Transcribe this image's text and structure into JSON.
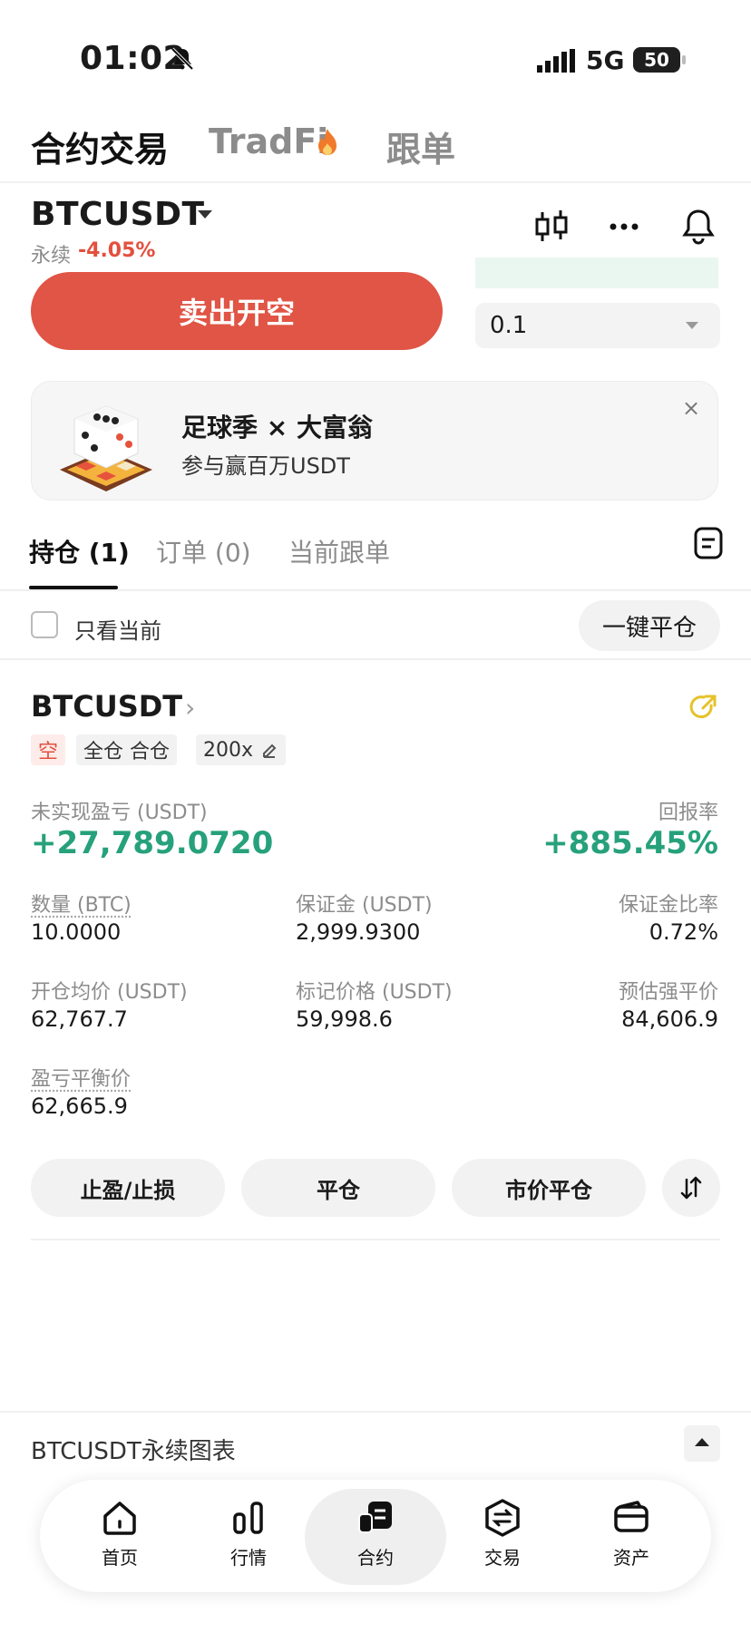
{
  "status_bar": {
    "time": "01:02",
    "network": "5G",
    "battery": "50"
  },
  "top_tabs": {
    "futures": "合约交易",
    "tradfi": "TradFi",
    "copy": "跟单"
  },
  "symbol_header": {
    "symbol": "BTCUSDT",
    "type": "永续",
    "change": "-4.05%"
  },
  "order_form": {
    "sell_button": "卖出开空",
    "quantity": "0.1"
  },
  "promo": {
    "title": "足球季 × 大富翁",
    "subtitle": "参与赢百万USDT",
    "close": "×"
  },
  "position_tabs": {
    "positions": "持仓 (1)",
    "orders": "订单 (0)",
    "copy": "当前跟单"
  },
  "filter": {
    "current_only": "只看当前",
    "close_all": "一键平仓"
  },
  "position": {
    "symbol": "BTCUSDT",
    "side_tag": "空",
    "margin_tag": "全仓 合仓",
    "leverage_tag": "200x",
    "unrealized_pnl_label": "未实现盈亏 (USDT)",
    "unrealized_pnl": "+27,789.0720",
    "roe_label": "回报率",
    "roe": "+885.45%",
    "qty_label": "数量 (BTC)",
    "qty": "10.0000",
    "margin_label": "保证金 (USDT)",
    "margin": "2,999.9300",
    "margin_ratio_label": "保证金比率",
    "margin_ratio": "0.72%",
    "entry_label": "开仓均价 (USDT)",
    "entry": "62,767.7",
    "mark_label": "标记价格 (USDT)",
    "mark": "59,998.6",
    "liq_label": "预估强平价",
    "liq": "84,606.9",
    "breakeven_label": "盈亏平衡价",
    "breakeven": "62,665.9",
    "actions": {
      "tpsl": "止盈/止损",
      "close": "平仓",
      "market_close": "市价平仓"
    }
  },
  "chart_bar": {
    "title": "BTCUSDT永续图表"
  },
  "bottom_nav": {
    "home": "首页",
    "markets": "行情",
    "futures": "合约",
    "trade": "交易",
    "assets": "资产"
  },
  "colors": {
    "sell": "#e05545",
    "profit": "#26a17b",
    "loss": "#e3503e",
    "tradfi_flame": "#f07a2a",
    "share": "#e6c229"
  },
  "icons": [
    "bell-off-icon",
    "signal-icon",
    "flame-icon",
    "candlestick-icon",
    "more-icon",
    "bell-icon",
    "close-icon",
    "note-icon",
    "chevron-right-icon",
    "share-icon",
    "edit-icon",
    "swap-icon",
    "caret-up-icon",
    "home-icon",
    "markets-icon",
    "futures-icon",
    "trade-icon",
    "wallet-icon"
  ]
}
